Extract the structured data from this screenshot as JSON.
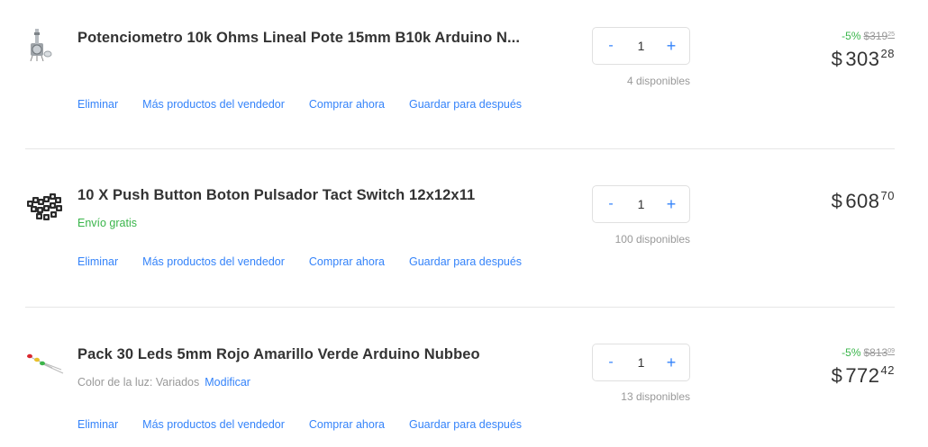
{
  "items": [
    {
      "thumb_icon": "potentiometer-image",
      "title": "Potenciometro 10k Ohms Lineal Pote 15mm B10k Arduino N...",
      "quantity": "1",
      "available": "4 disponibles",
      "discount_pct": "-5%",
      "old_price_int": "$319",
      "old_price_cents": "25",
      "currency": "$",
      "price_int": "303",
      "price_cents": "28"
    },
    {
      "thumb_icon": "push-button-image",
      "title": "10 X Push Button Boton Pulsador Tact Switch 12x12x11",
      "shipping": "Envío gratis",
      "quantity": "1",
      "available": "100 disponibles",
      "currency": "$",
      "price_int": "608",
      "price_cents": "70"
    },
    {
      "thumb_icon": "leds-image",
      "title": "Pack 30 Leds 5mm Rojo Amarillo Verde Arduino Nubbeo",
      "variant_label": "Color de la luz: Variados",
      "variant_link": "Modificar",
      "quantity": "1",
      "available": "13 disponibles",
      "discount_pct": "-5%",
      "old_price_int": "$813",
      "old_price_cents": "09",
      "currency": "$",
      "price_int": "772",
      "price_cents": "42"
    }
  ],
  "actions": {
    "remove": "Eliminar",
    "more_from_seller": "Más productos del vendedor",
    "buy_now": "Comprar ahora",
    "save_for_later": "Guardar para después"
  },
  "stepper": {
    "minus": "-",
    "plus": "+"
  },
  "colors": {
    "link": "#3483fa",
    "green": "#39b54a",
    "muted": "#999999",
    "text": "#333333"
  }
}
